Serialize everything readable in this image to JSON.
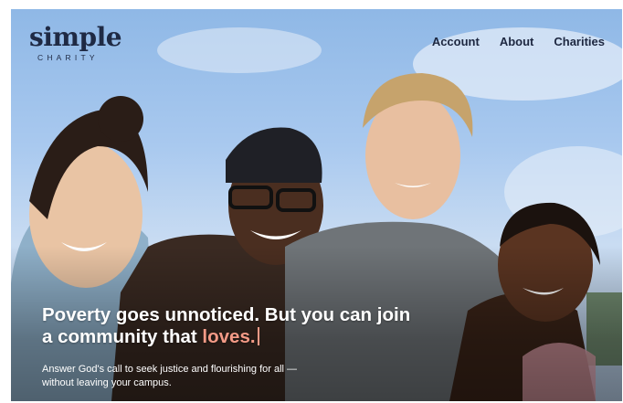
{
  "brand": {
    "name": "simple",
    "tagline": "CHARITY"
  },
  "nav": {
    "items": [
      {
        "label": "Account"
      },
      {
        "label": "About"
      },
      {
        "label": "Charities"
      }
    ]
  },
  "hero": {
    "headline_part1": "Poverty goes unnoticed. But you can join a community that ",
    "headline_accent": "loves.",
    "subtext": "Answer God's call to seek justice and flourishing for all — without leaving your campus."
  },
  "colors": {
    "accent": "#f39a86",
    "brand_text": "#1f2a44",
    "sky": "#a9c9ef"
  }
}
